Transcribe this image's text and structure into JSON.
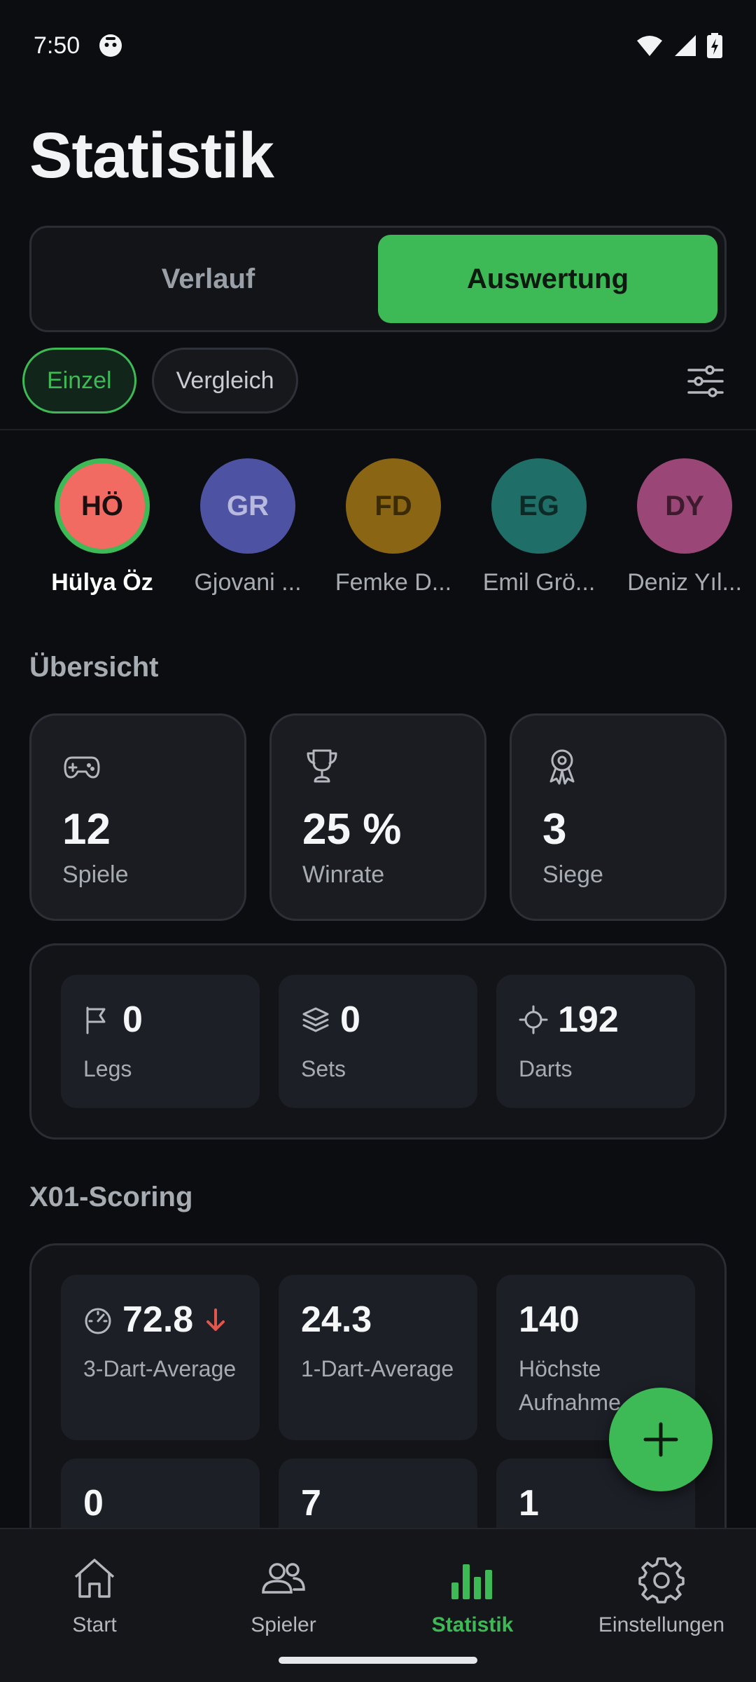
{
  "status": {
    "time": "7:50"
  },
  "page": {
    "title": "Statistik"
  },
  "tabs": [
    {
      "label": "Verlauf",
      "active": false
    },
    {
      "label": "Auswertung",
      "active": true
    }
  ],
  "chips": [
    {
      "label": "Einzel",
      "active": true
    },
    {
      "label": "Vergleich",
      "active": false
    }
  ],
  "players": [
    {
      "initials": "HÖ",
      "name": "Hülya Öz",
      "color": "#f26b63",
      "text_color": "#1b0f0f",
      "selected": true
    },
    {
      "initials": "GR",
      "name": "Gjovani ...",
      "color": "#4d52a3",
      "text_color": "#b7b9de",
      "selected": false
    },
    {
      "initials": "FD",
      "name": "Femke D...",
      "color": "#8a6514",
      "text_color": "#3a2a06",
      "selected": false
    },
    {
      "initials": "EG",
      "name": "Emil Grö...",
      "color": "#1f6f68",
      "text_color": "#0d2a27",
      "selected": false
    },
    {
      "initials": "DY",
      "name": "Deniz Yıl...",
      "color": "#9a4676",
      "text_color": "#3d1a2e",
      "selected": false
    }
  ],
  "overview": {
    "title": "Übersicht",
    "cards": [
      {
        "icon": "gamepad-icon",
        "value": "12",
        "label": "Spiele"
      },
      {
        "icon": "trophy-icon",
        "value": "25 %",
        "label": "Winrate"
      },
      {
        "icon": "award-icon",
        "value": "3",
        "label": "Siege"
      }
    ],
    "mini": [
      {
        "icon": "flag-icon",
        "value": "0",
        "label": "Legs"
      },
      {
        "icon": "layers-icon",
        "value": "0",
        "label": "Sets"
      },
      {
        "icon": "crosshair-icon",
        "value": "192",
        "label": "Darts"
      }
    ]
  },
  "x01": {
    "title": "X01-Scoring",
    "cards": [
      {
        "icon": "gauge-icon",
        "value": "72.8",
        "label": "3-Dart-Average",
        "trend": "down",
        "trend_color": "#e2574c"
      },
      {
        "value": "24.3",
        "label": "1-Dart-Average"
      },
      {
        "value": "140",
        "label": "Höchste Aufnahme"
      },
      {
        "value": "0",
        "label": ""
      },
      {
        "value": "7",
        "label": ""
      },
      {
        "value": "1",
        "label": ""
      }
    ]
  },
  "nav": [
    {
      "icon": "home-icon",
      "label": "Start",
      "active": false
    },
    {
      "icon": "users-icon",
      "label": "Spieler",
      "active": false
    },
    {
      "icon": "bar-chart-icon",
      "label": "Statistik",
      "active": true
    },
    {
      "icon": "gear-icon",
      "label": "Einstellungen",
      "active": false
    }
  ],
  "colors": {
    "accent": "#3dba56",
    "background": "#0c0d10",
    "card": "#1a1c22"
  }
}
